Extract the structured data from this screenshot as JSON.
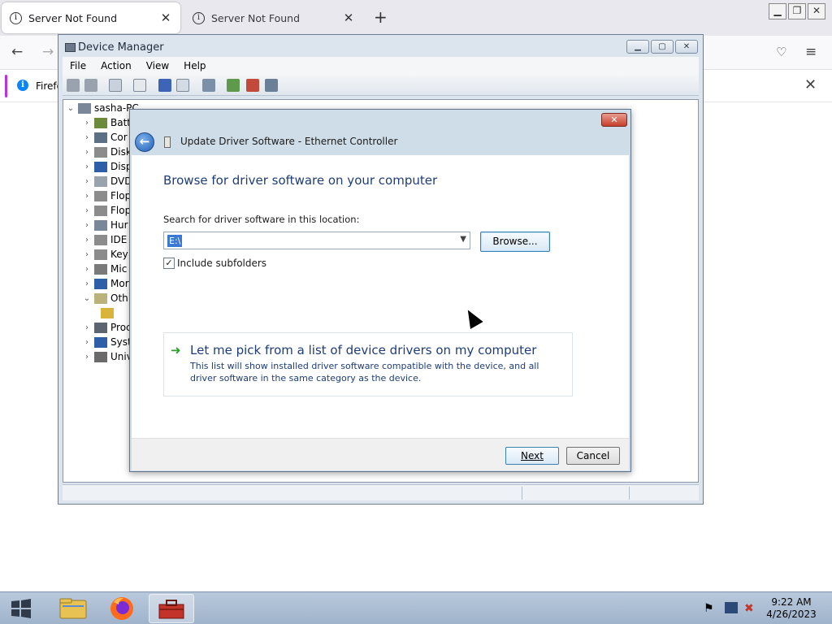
{
  "browser": {
    "tabs": [
      {
        "label": "Server Not Found",
        "active": true
      },
      {
        "label": "Server Not Found",
        "active": false
      }
    ],
    "close_glyph": "✕",
    "new_tab_glyph": "+",
    "notification": "Firefo"
  },
  "device_manager": {
    "title": "Device Manager",
    "menu": [
      "File",
      "Action",
      "View",
      "Help"
    ],
    "root": "sasha-PC",
    "categories": [
      "Batt",
      "Cor",
      "Disk",
      "Disp",
      "DVD",
      "Flop",
      "Flop",
      "Hur",
      "IDE",
      "Key",
      "Mic",
      "Mor",
      "Oth",
      "",
      "Proc",
      "Syst",
      "Univ"
    ]
  },
  "dialog": {
    "title": "Update Driver Software - Ethernet Controller",
    "heading": "Browse for driver software on your computer",
    "location_label": "Search for driver software in this location:",
    "location_value": "E:\\",
    "browse_label": "Browse...",
    "include_subfolders_label": "Include subfolders",
    "include_subfolders_checked": true,
    "pick_title": "Let me pick from a list of device drivers on my computer",
    "pick_description": "This list will show installed driver software compatible with the device, and all driver software in the same category as the device.",
    "next_label": "Next",
    "cancel_label": "Cancel"
  },
  "taskbar": {
    "time": "9:22 AM",
    "date": "4/26/2023"
  },
  "colors": {
    "dialog_heading": "#1e3d78",
    "firefox_accent": "#b833e1",
    "selection": "#3a78d4"
  }
}
